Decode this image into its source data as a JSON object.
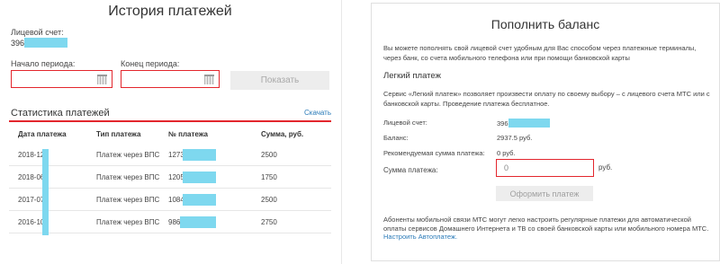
{
  "history": {
    "title": "История платежей",
    "account_label": "Лицевой счет:",
    "account_value": "396",
    "period_start_label": "Начало периода:",
    "period_end_label": "Конец периода:",
    "show_button": "Показать",
    "stats_title": "Статистика платежей",
    "download_link": "Скачать",
    "columns": [
      "Дата платежа",
      "Тип платежа",
      "№ платежа",
      "Сумма, руб."
    ],
    "rows": [
      {
        "date": "2018-12-",
        "type": "Платеж через ВПС",
        "number": "1273",
        "amount": "2500"
      },
      {
        "date": "2018-06-",
        "type": "Платеж через ВПС",
        "number": "1205",
        "amount": "1750"
      },
      {
        "date": "2017-07-",
        "type": "Платеж через ВПС",
        "number": "1084",
        "amount": "2500"
      },
      {
        "date": "2016-10-",
        "type": "Платеж через ВПС",
        "number": "986",
        "amount": "2750"
      }
    ]
  },
  "topup": {
    "title": "Пополнить баланс",
    "intro": "Вы можете пополнять свой лицевой счет удобным для Вас способом через платежные терминалы, через банк, со счета мобильного телефона или при помощи банковской карты",
    "easy_title": "Легкий платеж",
    "easy_text": "Сервис «Легкий платеж» позволяет произвести оплату по своему выбору – с лицевого счета МТС или с банковской карты. Проведение платежа бесплатное.",
    "account_label": "Лицевой счет:",
    "account_value": "396",
    "balance_label": "Баланс:",
    "balance_value": "2937.5 руб.",
    "recommended_label": "Рекомендуемая сумма платежа:",
    "recommended_value": "0 руб.",
    "sum_label": "Сумма платежа:",
    "sum_value": "0",
    "currency": "руб.",
    "submit_button": "Оформить платеж",
    "note": "Абоненты мобильной связи МТС могут легко настроить регулярные платежи для автоматической оплаты сервисов Домашнего Интернета и ТВ со своей банковской карты или мобильного номера МТС.",
    "autopay_link": "Настроить Автоплатеж."
  },
  "colors": {
    "accent": "#e3262d",
    "link": "#2a7ab8",
    "redaction": "#7ed8ef"
  }
}
